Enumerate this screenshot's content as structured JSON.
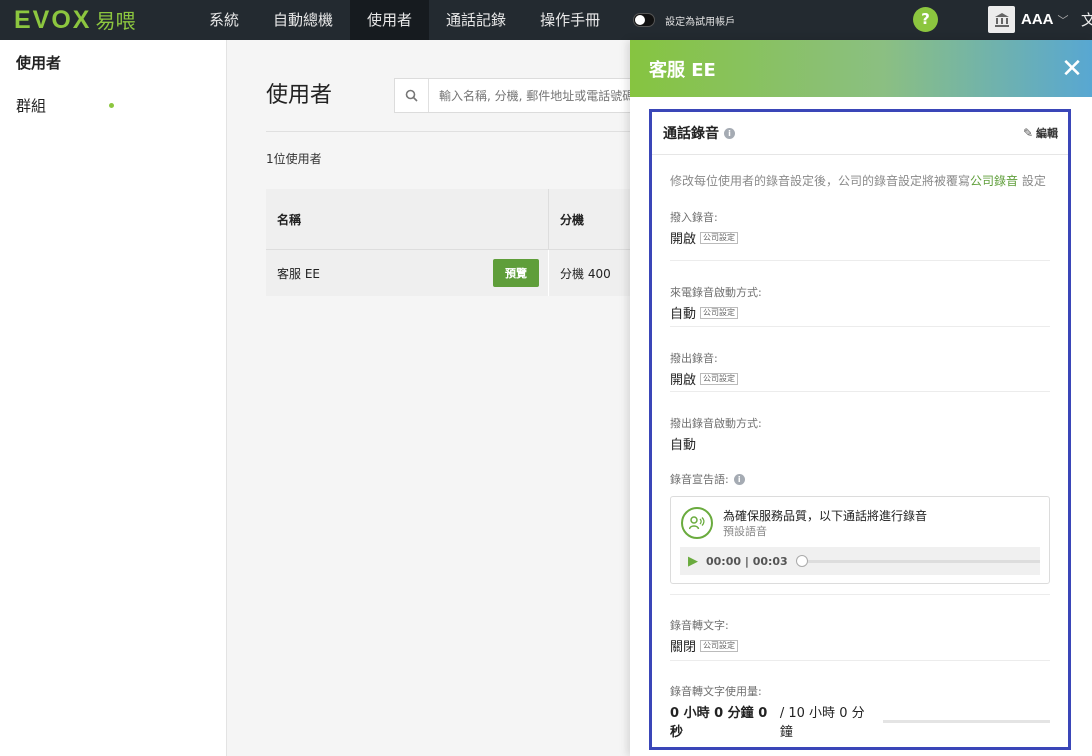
{
  "app": {
    "logo_main": "EVOX",
    "logo_sub": "易喂"
  },
  "nav": {
    "items": [
      "系統",
      "自動總機",
      "使用者",
      "通話記錄",
      "操作手冊"
    ],
    "active_index": 2,
    "trial_label": "設定為試用帳戶",
    "help_label": "?",
    "account_name": "AAA",
    "lang": "文"
  },
  "sidebar": {
    "items": [
      "使用者",
      "群組"
    ]
  },
  "main": {
    "title": "使用者",
    "search_placeholder": "輸入名稱, 分機, 郵件地址或電話號碼",
    "count": "1位使用者",
    "columns": [
      "名稱",
      "分機"
    ],
    "rows": [
      {
        "name": "客服 EE",
        "preview": "預覽",
        "ext": "分機 400"
      }
    ]
  },
  "drawer": {
    "title": "客服 EE",
    "close": "✕",
    "section_title": "通話錄音",
    "edit_label": "編輯",
    "note_prefix": "修改每位使用者的錄音設定後，公司的錄音設定將被覆寫",
    "note_link": "公司錄音",
    "note_suffix": " 設定",
    "tag": "公司設定",
    "fields": [
      {
        "label": "撥入錄音:",
        "value": "開啟"
      },
      {
        "label": "來電錄音啟動方式:",
        "value": "自動"
      },
      {
        "label": "撥出錄音:",
        "value": "開啟"
      },
      {
        "label": "撥出錄音啟動方式:",
        "value": "自動"
      }
    ],
    "announcement": {
      "label": "錄音宣告語:",
      "title": "為確保服務品質，以下通話將進行錄音",
      "subtitle": "預設語音",
      "time": "00:00 | 00:03",
      "progress": 0
    },
    "transcribe": {
      "label": "錄音轉文字:",
      "value": "關閉"
    },
    "usage": {
      "label": "錄音轉文字使用量:",
      "used": "0 小時 0 分鐘 0 秒",
      "total": "/ 10 小時 0 分鐘",
      "fraction": 0
    }
  },
  "colors": {
    "brand_green": "#8cc63f",
    "button_green": "#5f9e3a",
    "nav_bg": "#232a30",
    "highlight_border": "#3a46b8"
  }
}
